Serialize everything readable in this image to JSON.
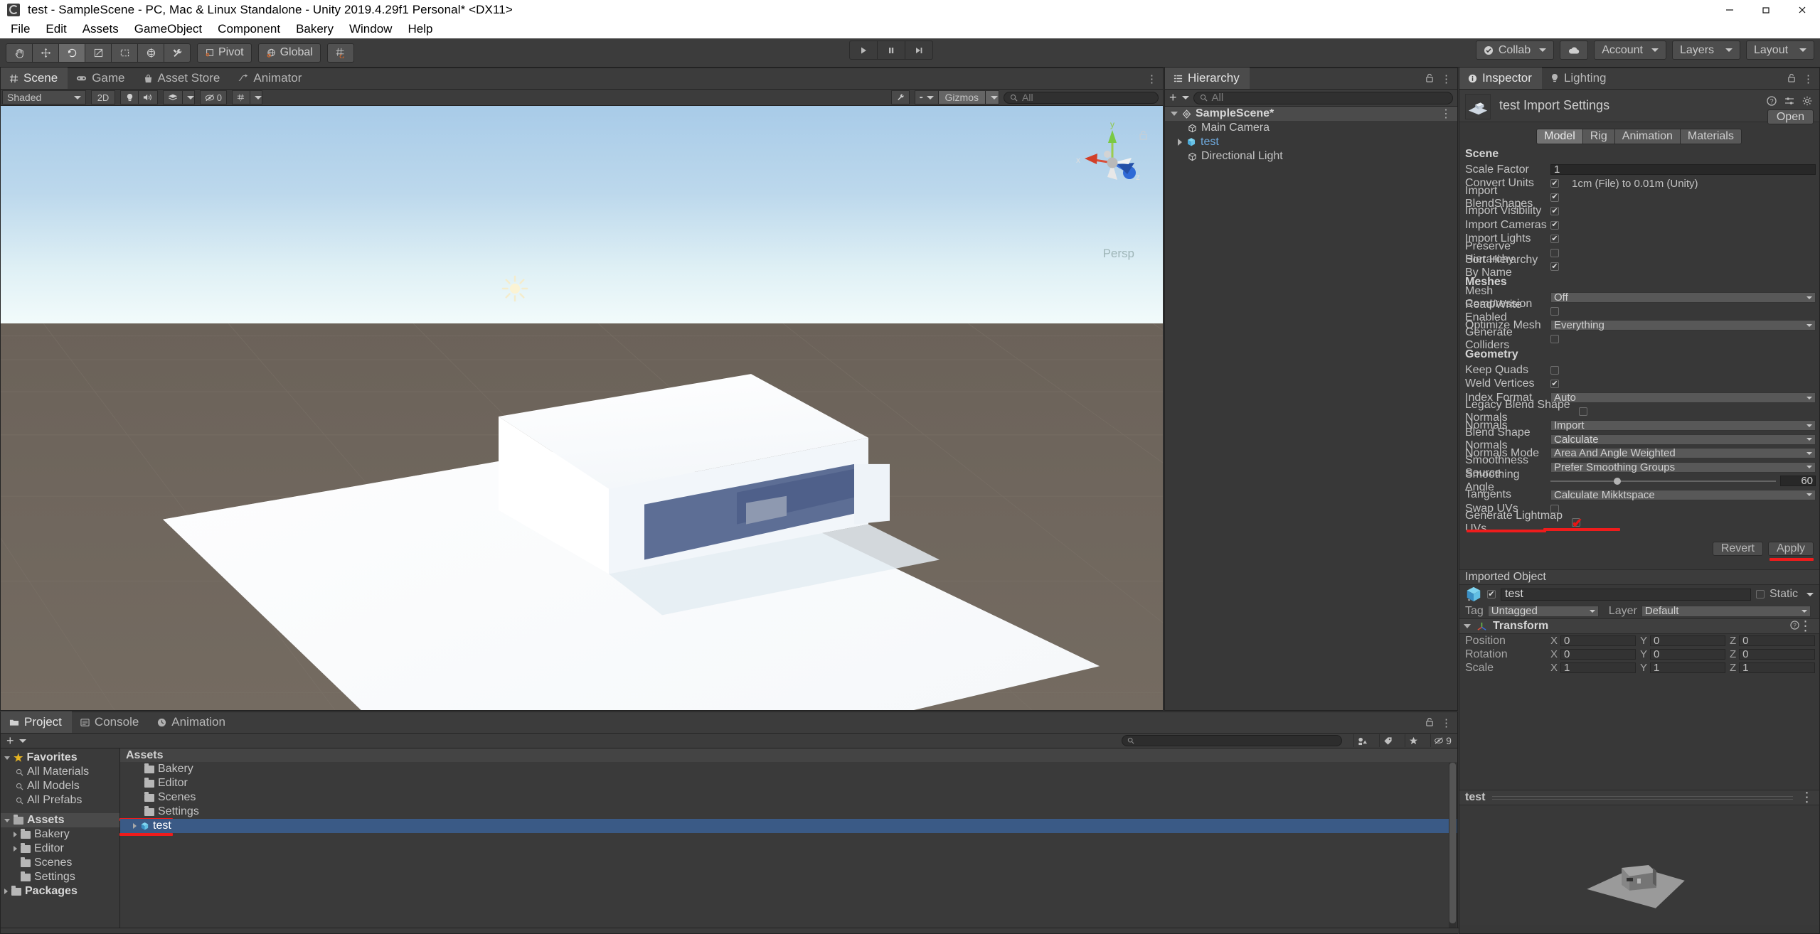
{
  "window": {
    "title": "test - SampleScene - PC, Mac & Linux Standalone - Unity 2019.4.29f1 Personal* <DX11>",
    "minimize": "—",
    "maximize": "❐",
    "close": "✕"
  },
  "menubar": {
    "items": [
      "File",
      "Edit",
      "Assets",
      "GameObject",
      "Component",
      "Bakery",
      "Window",
      "Help"
    ]
  },
  "toolbar": {
    "tools": [
      "hand-tool",
      "move-tool",
      "rotate-tool",
      "scale-tool",
      "rect-tool",
      "transform-tool",
      "custom-tool"
    ],
    "pivot_label": "Pivot",
    "global_label": "Global",
    "play": "▶",
    "pause": "❚❚",
    "step": "▶❘",
    "collab_label": "Collab",
    "cloud_label": "cloud-icon",
    "account_label": "Account",
    "layers_label": "Layers",
    "layout_label": "Layout"
  },
  "scene": {
    "tabs": [
      {
        "label": "Scene",
        "icon": "grid-icon",
        "active": true
      },
      {
        "label": "Game",
        "icon": "gamepad-icon",
        "active": false
      },
      {
        "label": "Asset Store",
        "icon": "store-icon",
        "active": false
      },
      {
        "label": "Animator",
        "icon": "animator-icon",
        "active": false
      }
    ],
    "shading_mode": "Shaded",
    "mode_2d": "2D",
    "audio_toggle": "audio-icon",
    "light_toggle": "light-icon",
    "fx_label": "effects-icon",
    "hidden_count": "0",
    "grid_label": "grid-snap-icon",
    "gizmos_label": "Gizmos",
    "search_placeholder": "All",
    "axis_x": "x",
    "axis_y": "y",
    "axis_z": "z",
    "perspective_label": "Persp"
  },
  "hierarchy": {
    "tab_label": "Hierarchy",
    "create_label": "+",
    "search_placeholder": "All",
    "items": [
      {
        "label": "SampleScene*",
        "depth": 0,
        "expanded": true,
        "bold": true,
        "icon": "scene-icon",
        "selected": false
      },
      {
        "label": "Main Camera",
        "depth": 1,
        "expanded": null,
        "bold": false,
        "icon": "gameobject-icon",
        "selected": false
      },
      {
        "label": "test",
        "depth": 1,
        "expanded": false,
        "bold": false,
        "icon": "prefab-icon",
        "selected": false,
        "blue": true
      },
      {
        "label": "Directional Light",
        "depth": 1,
        "expanded": null,
        "bold": false,
        "icon": "gameobject-icon",
        "selected": false
      }
    ]
  },
  "inspector": {
    "tabs": [
      {
        "label": "Inspector",
        "icon": "info-icon",
        "active": true
      },
      {
        "label": "Lighting",
        "icon": "bulb-icon",
        "active": false
      }
    ],
    "title": "test Import Settings",
    "open_button": "Open",
    "model_tabs": [
      {
        "label": "Model",
        "active": true
      },
      {
        "label": "Rig",
        "active": false
      },
      {
        "label": "Animation",
        "active": false
      },
      {
        "label": "Materials",
        "active": false
      }
    ],
    "sections": [
      {
        "header": "Scene",
        "rows": [
          {
            "label": "Scale Factor",
            "type": "text",
            "value": "1"
          },
          {
            "label": "Convert Units",
            "type": "checkbox",
            "checked": true,
            "note": "1cm (File) to 0.01m (Unity)"
          },
          {
            "label": "Import BlendShapes",
            "type": "checkbox",
            "checked": true
          },
          {
            "label": "Import Visibility",
            "type": "checkbox",
            "checked": true
          },
          {
            "label": "Import Cameras",
            "type": "checkbox",
            "checked": true
          },
          {
            "label": "Import Lights",
            "type": "checkbox",
            "checked": true
          },
          {
            "label": "Preserve Hierarchy",
            "type": "checkbox",
            "checked": false
          },
          {
            "label": "Sort Hierarchy By Name",
            "type": "checkbox",
            "checked": true
          }
        ]
      },
      {
        "header": "Meshes",
        "rows": [
          {
            "label": "Mesh Compression",
            "type": "dropdown",
            "value": "Off"
          },
          {
            "label": "Read/Write Enabled",
            "type": "checkbox",
            "checked": false
          },
          {
            "label": "Optimize Mesh",
            "type": "dropdown",
            "value": "Everything"
          },
          {
            "label": "Generate Colliders",
            "type": "checkbox",
            "checked": false
          }
        ]
      },
      {
        "header": "Geometry",
        "rows": [
          {
            "label": "Keep Quads",
            "type": "checkbox",
            "checked": false
          },
          {
            "label": "Weld Vertices",
            "type": "checkbox",
            "checked": true
          },
          {
            "label": "Index Format",
            "type": "dropdown",
            "value": "Auto"
          },
          {
            "label": "Legacy Blend Shape Normals",
            "type": "checkbox",
            "checked": false
          },
          {
            "label": "Normals",
            "type": "dropdown",
            "value": "Import"
          },
          {
            "label": "Blend Shape Normals",
            "type": "dropdown",
            "value": "Calculate"
          },
          {
            "label": "Normals Mode",
            "type": "dropdown",
            "value": "Area And Angle Weighted"
          },
          {
            "label": "Smoothness Source",
            "type": "dropdown",
            "value": "Prefer Smoothing Groups"
          },
          {
            "label": "Smoothing Angle",
            "type": "slider",
            "value": "60"
          },
          {
            "label": "Tangents",
            "type": "dropdown",
            "value": "Calculate Mikktspace"
          },
          {
            "label": "Swap UVs",
            "type": "checkbox",
            "checked": false
          },
          {
            "label": "Generate Lightmap UVs",
            "type": "checkbox-red",
            "checked": true
          }
        ]
      }
    ],
    "revert_button": "Revert",
    "apply_button": "Apply",
    "imported_object_header": "Imported Object",
    "object": {
      "name": "test",
      "enabled": true,
      "static_label": "Static",
      "tag_label": "Tag",
      "tag_value": "Untagged",
      "layer_label": "Layer",
      "layer_value": "Default"
    },
    "transform": {
      "title": "Transform",
      "rows": [
        {
          "label": "Position",
          "x": "0",
          "y": "0",
          "z": "0"
        },
        {
          "label": "Rotation",
          "x": "0",
          "y": "0",
          "z": "0"
        },
        {
          "label": "Scale",
          "x": "1",
          "y": "1",
          "z": "1"
        }
      ],
      "axis_labels": [
        "X",
        "Y",
        "Z"
      ]
    },
    "preview": {
      "title": "test"
    }
  },
  "project": {
    "tabs": [
      {
        "label": "Project",
        "icon": "folder-icon",
        "active": true
      },
      {
        "label": "Console",
        "icon": "console-icon",
        "active": false
      },
      {
        "label": "Animation",
        "icon": "clock-icon",
        "active": false
      }
    ],
    "create_label": "+",
    "tree": [
      {
        "label": "Favorites",
        "depth": 0,
        "type": "favorites",
        "expanded": true
      },
      {
        "label": "All Materials",
        "depth": 1,
        "type": "search"
      },
      {
        "label": "All Models",
        "depth": 1,
        "type": "search"
      },
      {
        "label": "All Prefabs",
        "depth": 1,
        "type": "search"
      },
      {
        "label": "Assets",
        "depth": 0,
        "type": "folder-open",
        "expanded": true,
        "selected": true
      },
      {
        "label": "Bakery",
        "depth": 1,
        "type": "folder",
        "expanded": false
      },
      {
        "label": "Editor",
        "depth": 1,
        "type": "folder",
        "expanded": false
      },
      {
        "label": "Scenes",
        "depth": 1,
        "type": "folder"
      },
      {
        "label": "Settings",
        "depth": 1,
        "type": "folder"
      },
      {
        "label": "Packages",
        "depth": 0,
        "type": "folder",
        "expanded": false
      }
    ],
    "content_header": "Assets",
    "content_items": [
      {
        "label": "Bakery",
        "type": "folder",
        "selected": false
      },
      {
        "label": "Editor",
        "type": "folder",
        "selected": false
      },
      {
        "label": "Scenes",
        "type": "folder",
        "selected": false
      },
      {
        "label": "Settings",
        "type": "folder",
        "selected": false
      },
      {
        "label": "test",
        "type": "model",
        "selected": true,
        "expandable": true
      }
    ],
    "search_placeholder": "",
    "filter_buttons": [
      "asset-type-filter-icon",
      "label-filter-icon",
      "favorite-filter-icon"
    ],
    "hidden_count": "9"
  },
  "colors": {
    "accent_blue": "#3a5a86",
    "annotation_red": "#ee1c1c",
    "panel_bg": "#383838",
    "toolbar_bg": "#3c3c3c",
    "link_blue": "#6ea8dc"
  }
}
